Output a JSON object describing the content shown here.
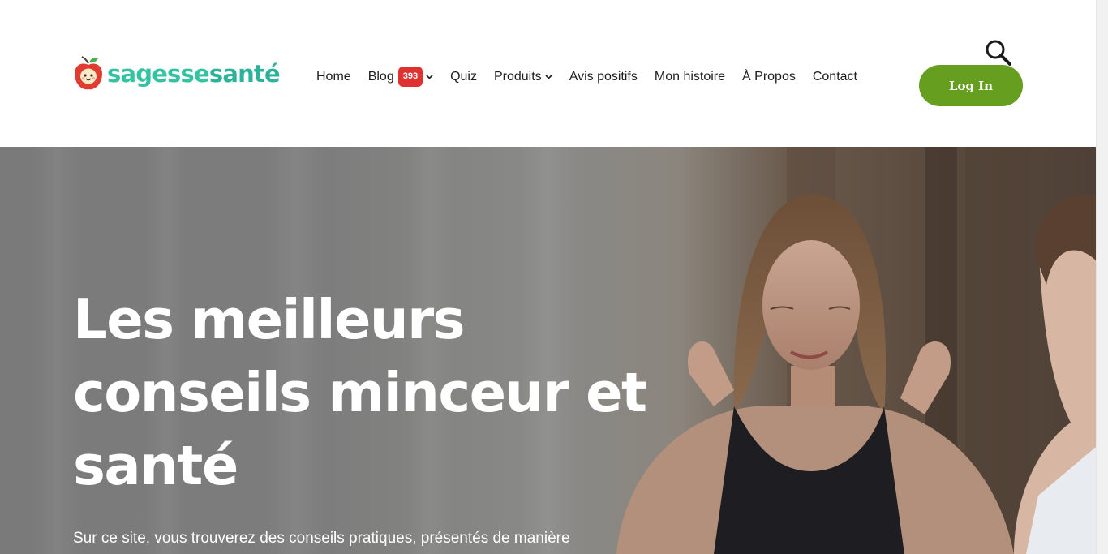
{
  "brand": {
    "name_part1": "sagesse",
    "name_part2": "santé",
    "colors": {
      "teal": "#33c3a0",
      "apple_red": "#e03c31",
      "leaf_green": "#4caf50"
    }
  },
  "nav": {
    "items": [
      {
        "label": "Home",
        "has_dropdown": false
      },
      {
        "label": "Blog",
        "badge": "393",
        "has_dropdown": true
      },
      {
        "label": "Quiz",
        "has_dropdown": false
      },
      {
        "label": "Produits",
        "has_dropdown": true
      },
      {
        "label": "Avis positifs",
        "has_dropdown": false
      },
      {
        "label": "Mon histoire",
        "has_dropdown": false
      },
      {
        "label": "À Propos",
        "has_dropdown": false
      },
      {
        "label": "Contact",
        "has_dropdown": false
      }
    ],
    "badge_color": "#e03131"
  },
  "header": {
    "search_icon": "magnifier-icon",
    "login_label": "Log In",
    "login_color": "#669e1f"
  },
  "hero": {
    "title_line1": "Les meilleurs",
    "title_line2": "conseils minceur et",
    "title_line3": "santé",
    "subtitle": "Sur ce site, vous trouverez des conseils pratiques, présentés de manière"
  }
}
